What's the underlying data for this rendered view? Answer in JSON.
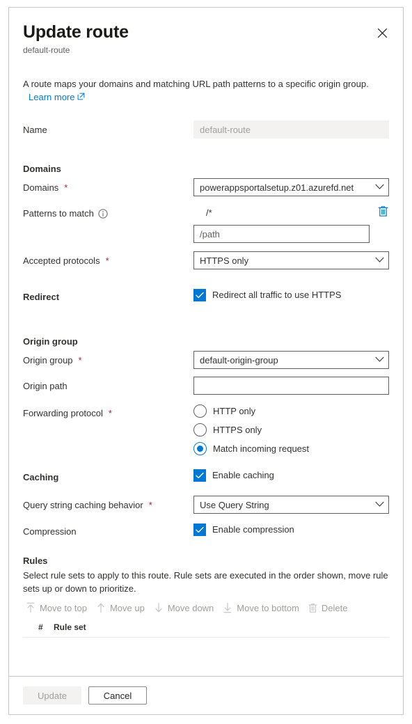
{
  "dialog": {
    "title": "Update route",
    "subtitle": "default-route",
    "close_icon": "close-icon",
    "intro_text": "A route maps your domains and matching URL path patterns to a specific origin group.",
    "learn_more_label": "Learn more",
    "learn_more_icon": "external-link-icon"
  },
  "form": {
    "name": {
      "label": "Name",
      "value": "default-route",
      "readonly": true
    },
    "domains_section": {
      "heading": "Domains",
      "domains": {
        "label": "Domains",
        "required": true,
        "value": "powerappsportalsetup.z01.azurefd.net",
        "chevron_icon": "chevron-down-icon"
      },
      "patterns_to_match": {
        "label": "Patterns to match",
        "info_icon": "info-icon",
        "pattern_value": "/*",
        "delete_icon": "trash-icon",
        "new_pattern_placeholder": "/path",
        "new_pattern_value": ""
      },
      "accepted_protocols": {
        "label": "Accepted protocols",
        "required": true,
        "value": "HTTPS only",
        "chevron_icon": "chevron-down-icon"
      }
    },
    "redirect": {
      "label": "Redirect",
      "checkbox_label": "Redirect all traffic to use HTTPS",
      "checked": true,
      "check_icon": "checkmark-icon"
    },
    "origin_group_section": {
      "heading": "Origin group",
      "origin_group": {
        "label": "Origin group",
        "required": true,
        "value": "default-origin-group",
        "chevron_icon": "chevron-down-icon"
      },
      "origin_path": {
        "label": "Origin path",
        "value": "",
        "placeholder": ""
      },
      "forwarding_protocol": {
        "label": "Forwarding protocol",
        "required": true,
        "options": [
          {
            "label": "HTTP only",
            "selected": false
          },
          {
            "label": "HTTPS only",
            "selected": false
          },
          {
            "label": "Match incoming request",
            "selected": true
          }
        ]
      }
    },
    "caching_section": {
      "heading": "Caching",
      "enable_caching": {
        "checkbox_label": "Enable caching",
        "checked": true,
        "check_icon": "checkmark-icon"
      },
      "query_string_behavior": {
        "label": "Query string caching behavior",
        "required": true,
        "value": "Use Query String",
        "chevron_icon": "chevron-down-icon"
      },
      "compression": {
        "label": "Compression",
        "checkbox_label": "Enable compression",
        "checked": true,
        "check_icon": "checkmark-icon"
      }
    }
  },
  "rules": {
    "heading": "Rules",
    "description": "Select rule sets to apply to this route. Rule sets are executed in the order shown, move rule sets up or down to prioritize.",
    "commands": [
      {
        "label": "Move to top",
        "icon": "arrow-up-to-line-icon",
        "disabled": true
      },
      {
        "label": "Move up",
        "icon": "arrow-up-icon",
        "disabled": true
      },
      {
        "label": "Move down",
        "icon": "arrow-down-icon",
        "disabled": true
      },
      {
        "label": "Move to bottom",
        "icon": "arrow-down-to-line-icon",
        "disabled": true
      },
      {
        "label": "Delete",
        "icon": "trash-icon",
        "disabled": true
      }
    ],
    "table": {
      "columns": [
        "#",
        "Rule set"
      ],
      "rows": []
    }
  },
  "footer": {
    "update_label": "Update",
    "update_disabled": true,
    "cancel_label": "Cancel"
  },
  "colors": {
    "accent": "#0078d4",
    "required_asterisk": "#a4262c",
    "border": "#c8c6c4",
    "disabled_text": "#a19f9d",
    "readonly_bg": "#f3f2f1"
  }
}
